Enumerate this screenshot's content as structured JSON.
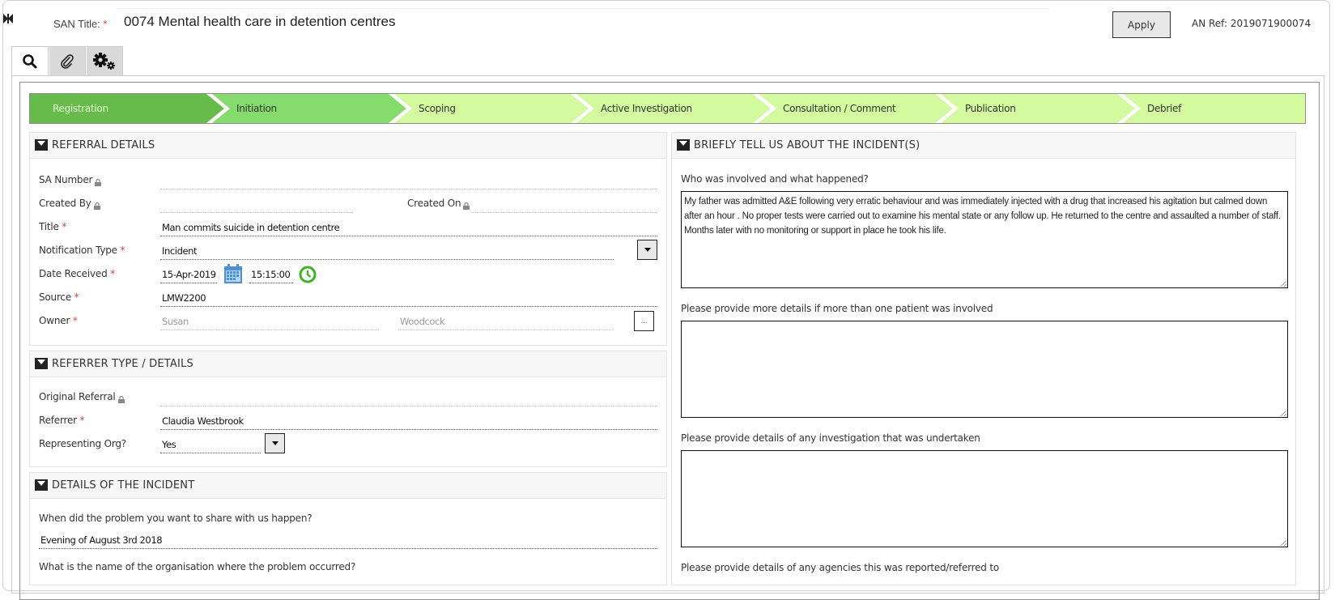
{
  "header": {
    "san_title_label": "SAN Title:",
    "required_mark": "*",
    "san_title_value": "0074 Mental health care in detention centres",
    "apply_label": "Apply",
    "an_ref": "AN Ref: 2019071900074"
  },
  "tabs": [
    {
      "icon": "search-icon",
      "active": true
    },
    {
      "icon": "paperclip-icon",
      "active": false
    },
    {
      "icon": "gears-icon",
      "active": false
    }
  ],
  "stepper": {
    "steps": [
      {
        "label": "Registration",
        "state": "done"
      },
      {
        "label": "Initiation",
        "state": "current"
      },
      {
        "label": "Scoping",
        "state": "pending"
      },
      {
        "label": "Active Investigation",
        "state": "pending"
      },
      {
        "label": "Consultation / Comment",
        "state": "pending"
      },
      {
        "label": "Publication",
        "state": "pending"
      },
      {
        "label": "Debrief",
        "state": "pending"
      }
    ],
    "colors": {
      "done": "#66bb4a",
      "current": "#85db6b",
      "pending": "#d3fa9f"
    }
  },
  "referral_details": {
    "title": "REFERRAL DETAILS",
    "sa_number_label": "SA Number",
    "sa_number_value": "",
    "created_by_label": "Created By",
    "created_by_value": "",
    "created_on_label": "Created On",
    "created_on_value": "",
    "title_label": "Title",
    "title_value": "Man commits suicide in detention centre",
    "notification_type_label": "Notification Type",
    "notification_type_value": "Incident",
    "date_received_label": "Date Received",
    "date_value": "15-Apr-2019",
    "time_value": "15:15:00",
    "source_label": "Source",
    "source_value": "LMW2200",
    "owner_label": "Owner",
    "owner_first": "Susan",
    "owner_last": "Woodcock",
    "owner_lookup_label": "..."
  },
  "referrer": {
    "title": "REFERRER TYPE / DETAILS",
    "original_referral_label": "Original Referral",
    "original_referral_value": "",
    "referrer_label": "Referrer",
    "referrer_value": "Claudia Westbrook",
    "representing_org_label": "Representing Org?",
    "representing_org_value": "Yes"
  },
  "incident_details": {
    "title": "DETAILS OF THE INCIDENT",
    "q1": "When did the problem you want to share with us happen?",
    "a1": "Evening of August 3rd 2018",
    "q2": "What is the name of the organisation where the problem occurred?"
  },
  "incident_story": {
    "title": "BRIEFLY TELL US ABOUT THE INCIDENT(S)",
    "q1": "Who was involved and what happened?",
    "a1": "My father was admitted A&E following very erratic behaviour and was immediately injected with a drug that increased his agitation but calmed down after an hour . No proper tests were carried out to examine his mental state or any follow up. He returned to the centre and assaulted a number of staff. Months later with no monitoring or support in place he took his life.",
    "q2": "Please provide more details if more than one patient was involved",
    "a2": "",
    "q3": "Please provide details of any investigation that was undertaken",
    "a3": "",
    "q4": "Please provide details of any agencies this was reported/referred to"
  }
}
